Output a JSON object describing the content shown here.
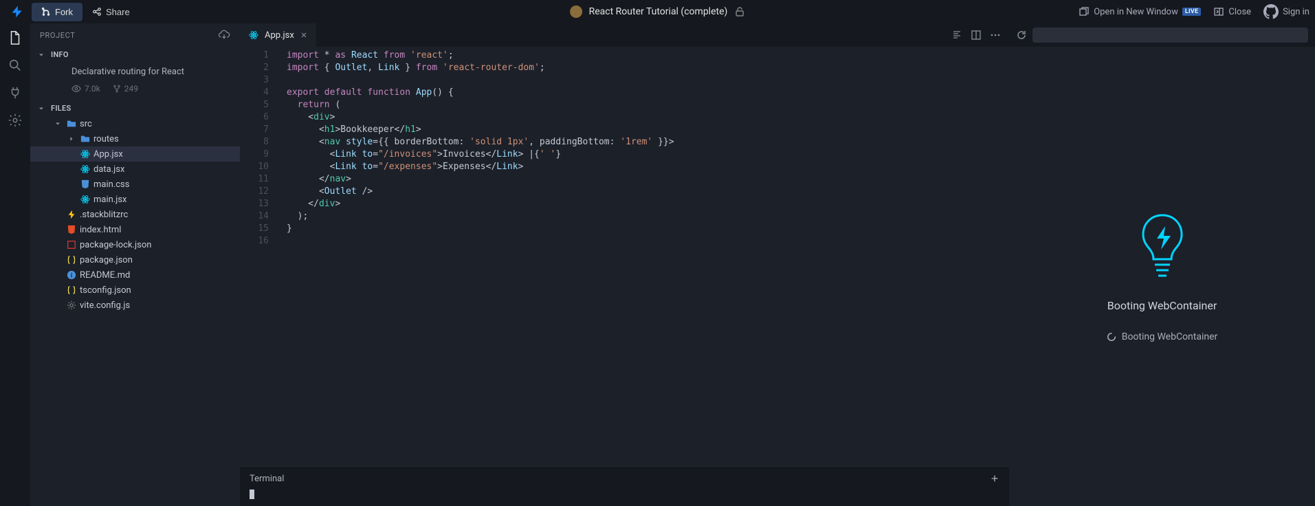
{
  "topbar": {
    "fork_label": "Fork",
    "share_label": "Share",
    "title": "React Router Tutorial (complete)",
    "open_new_window": "Open in New Window",
    "live_badge": "LIVE",
    "close_label": "Close",
    "signin_label": "Sign in"
  },
  "sidebar": {
    "project_label": "PROJECT",
    "info_label": "INFO",
    "description": "Declarative routing for React",
    "views": "7.0k",
    "forks": "249",
    "files_label": "FILES",
    "tree": {
      "src": "src",
      "routes": "routes",
      "app_jsx": "App.jsx",
      "data_jsx": "data.jsx",
      "main_css": "main.css",
      "main_jsx": "main.jsx",
      "stackblitzrc": ".stackblitzrc",
      "index_html": "index.html",
      "package_lock": "package-lock.json",
      "package_json": "package.json",
      "readme": "README.md",
      "tsconfig": "tsconfig.json",
      "vite_config": "vite.config.js"
    }
  },
  "editor": {
    "tab_label": "App.jsx",
    "lines": [
      "import * as React from 'react';",
      "import { Outlet, Link } from 'react-router-dom';",
      "",
      "export default function App() {",
      "  return (",
      "    <div>",
      "      <h1>Bookkeeper</h1>",
      "      <nav style={{ borderBottom: 'solid 1px', paddingBottom: '1rem' }}>",
      "        <Link to=\"/invoices\">Invoices</Link> |{' '}",
      "        <Link to=\"/expenses\">Expenses</Link>",
      "      </nav>",
      "      <Outlet />",
      "    </div>",
      "  );",
      "}",
      ""
    ]
  },
  "terminal": {
    "label": "Terminal"
  },
  "preview": {
    "boot_title": "Booting WebContainer",
    "boot_status": "Booting WebContainer"
  }
}
